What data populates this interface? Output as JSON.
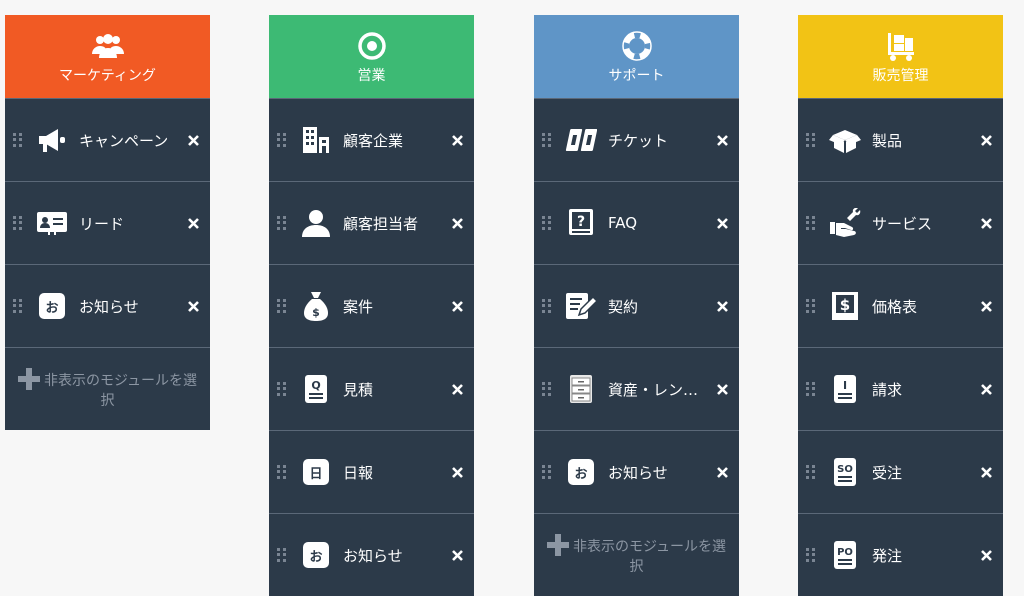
{
  "columns": [
    {
      "title": "マーケティング",
      "color": "#f15a24",
      "items": [
        {
          "label": "キャンペーン"
        },
        {
          "label": "リード"
        },
        {
          "label": "お知らせ",
          "badge": "お"
        }
      ],
      "hidden_select": "非表示のモジュールを選択"
    },
    {
      "title": "営業",
      "color": "#3dba74",
      "items": [
        {
          "label": "顧客企業"
        },
        {
          "label": "顧客担当者"
        },
        {
          "label": "案件"
        },
        {
          "label": "見積"
        },
        {
          "label": "日報",
          "badge": "日"
        },
        {
          "label": "お知らせ",
          "badge": "お"
        }
      ]
    },
    {
      "title": "サポート",
      "color": "#5f95c7",
      "items": [
        {
          "label": "チケット"
        },
        {
          "label": "FAQ"
        },
        {
          "label": "契約"
        },
        {
          "label": "資産・レン…"
        },
        {
          "label": "お知らせ",
          "badge": "お"
        }
      ],
      "hidden_select": "非表示のモジュールを選択"
    },
    {
      "title": "販売管理",
      "color": "#f2c315",
      "items": [
        {
          "label": "製品"
        },
        {
          "label": "サービス"
        },
        {
          "label": "価格表"
        },
        {
          "label": "請求"
        },
        {
          "label": "受注"
        },
        {
          "label": "発注"
        }
      ]
    }
  ]
}
